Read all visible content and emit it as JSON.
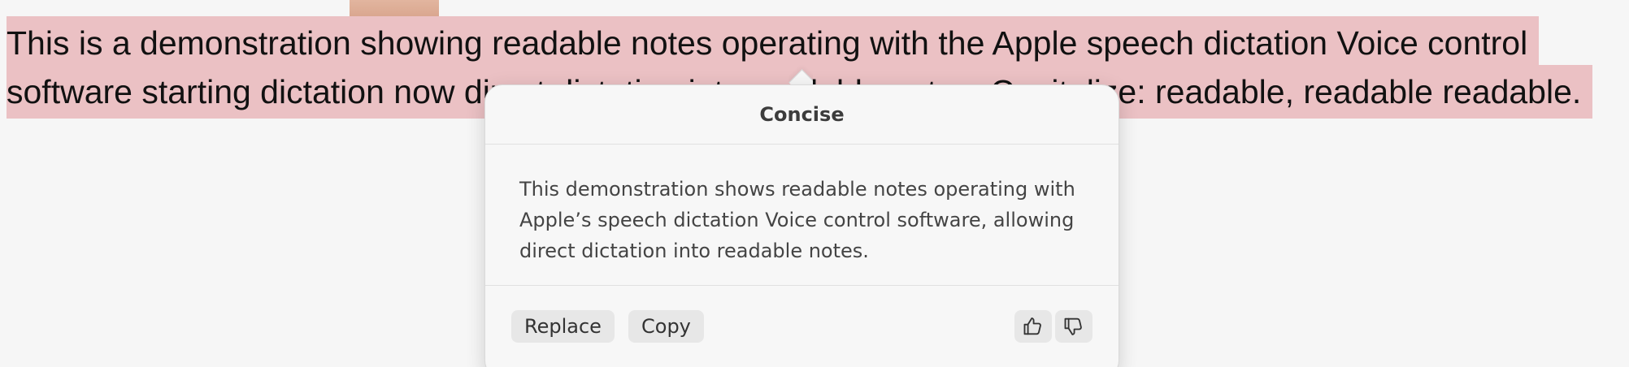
{
  "document": {
    "text": "This is a demonstration showing readable notes operating with the Apple speech dictation Voice control software starting dictation now direct dictation into readable notes. Capitalize: readable, readable readable."
  },
  "popover": {
    "title": "Concise",
    "summary": "This demonstration shows readable notes operating with Apple’s speech dictation Voice control software, allowing direct dictation into readable notes.",
    "actions": {
      "replace_label": "Replace",
      "copy_label": "Copy"
    },
    "feedback": {
      "thumbs_up_icon": "thumbs-up-icon",
      "thumbs_down_icon": "thumbs-down-icon"
    }
  },
  "colors": {
    "selection_highlight": "#ebc1c4",
    "background": "#f6f6f6",
    "popover_background": "#f7f7f7"
  }
}
